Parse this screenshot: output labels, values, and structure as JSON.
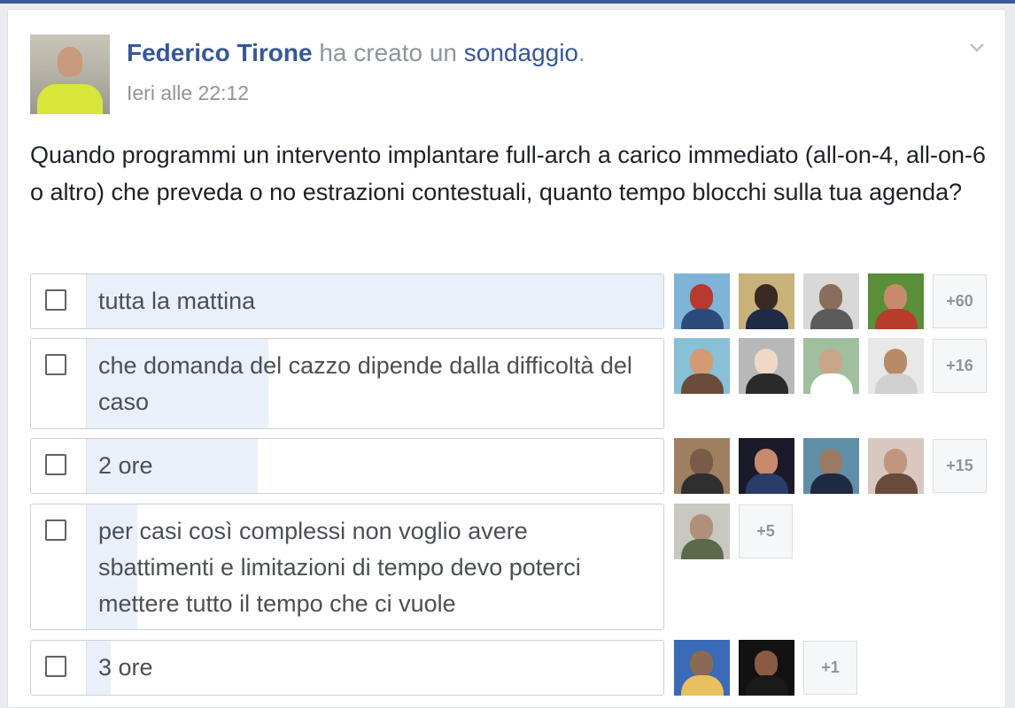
{
  "post": {
    "author": "Federico Tirone",
    "action": "ha creato un",
    "object": "sondaggio",
    "punct": ".",
    "time": "Ieri alle 22:12"
  },
  "question": "Quando programmi un intervento implantare full-arch a carico immediato (all-on-4, all-on-6 o altro) che preveda o no estrazioni contestuali, quanto tempo blocchi sulla tua agenda?",
  "options": [
    {
      "label": "tutta la mattina",
      "vote_share": 1.0,
      "more": "+60",
      "voter_avatars": 4
    },
    {
      "label": "che domanda del cazzo dipende dalla difficoltà del caso",
      "vote_share": 0.31,
      "more": "+16",
      "voter_avatars": 4
    },
    {
      "label": "2 ore",
      "vote_share": 0.29,
      "more": "+15",
      "voter_avatars": 4
    },
    {
      "label": "per casi così complessi non voglio avere sbattimenti e limitazioni di tempo devo poterci mettere tutto il tempo che ci vuole",
      "vote_share": 0.09,
      "more": "+5",
      "voter_avatars": 1
    },
    {
      "label": "3 ore",
      "vote_share": 0.04,
      "more": "+1",
      "voter_avatars": 2
    }
  ],
  "colors": {
    "link": "#365899",
    "secondary_text": "#90949c",
    "poll_fill": "#eaf0f9",
    "top_bar": "#3b5998"
  },
  "icons": [
    "chevron-down-icon",
    "checkbox-icon"
  ]
}
